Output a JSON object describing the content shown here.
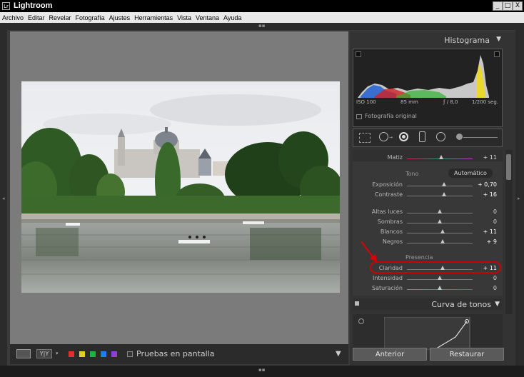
{
  "window": {
    "title": "Lightroom",
    "app_icon": "Lr",
    "min_btn": "_",
    "max_btn": "□",
    "close_btn": "X"
  },
  "menu": [
    "Archivo",
    "Editar",
    "Revelar",
    "Fotografía",
    "Ajustes",
    "Herramientas",
    "Vista",
    "Ventana",
    "Ayuda"
  ],
  "histogram": {
    "title": "Histograma",
    "iso": "ISO 100",
    "focal": "85 mm",
    "aperture": "ƒ / 8,0",
    "shutter": "1/200 seg.",
    "original_photo": "Fotografía original"
  },
  "basic": {
    "matiz_label": "Matiz",
    "matiz_value": "+ 11",
    "tono_label": "Tono",
    "auto_label": "Automático",
    "exposicion_label": "Exposición",
    "exposicion_value": "+ 0,70",
    "exposicion_level": 0.58,
    "contraste_label": "Contraste",
    "contraste_value": "+ 16",
    "contraste_level": 0.58,
    "altas_luces_label": "Altas luces",
    "altas_luces_value": "0",
    "altas_luces_level": 0.5,
    "sombras_label": "Sombras",
    "sombras_value": "0",
    "sombras_level": 0.5,
    "blancos_label": "Blancos",
    "blancos_value": "+ 11",
    "blancos_level": 0.55,
    "negros_label": "Negros",
    "negros_value": "+ 9",
    "negros_level": 0.55,
    "presencia_label": "Presencia",
    "claridad_label": "Claridad",
    "claridad_value": "+ 11",
    "claridad_level": 0.55,
    "intensidad_label": "Intensidad",
    "intensidad_value": "0",
    "intensidad_level": 0.5,
    "saturacion_label": "Saturación",
    "saturacion_value": "0",
    "saturacion_level": 0.5
  },
  "curve": {
    "title": "Curva de tonos"
  },
  "buttons": {
    "anterior": "Anterior",
    "restaurar": "Restaurar"
  },
  "toolbar": {
    "soft_proof": "Pruebas en pantalla",
    "compare_label": "Y|Y"
  },
  "colors": {
    "accent_red": "#cc0000",
    "label_colors": [
      "#e03030",
      "#e0d020",
      "#20b040",
      "#2080e0",
      "#9040d0"
    ]
  }
}
